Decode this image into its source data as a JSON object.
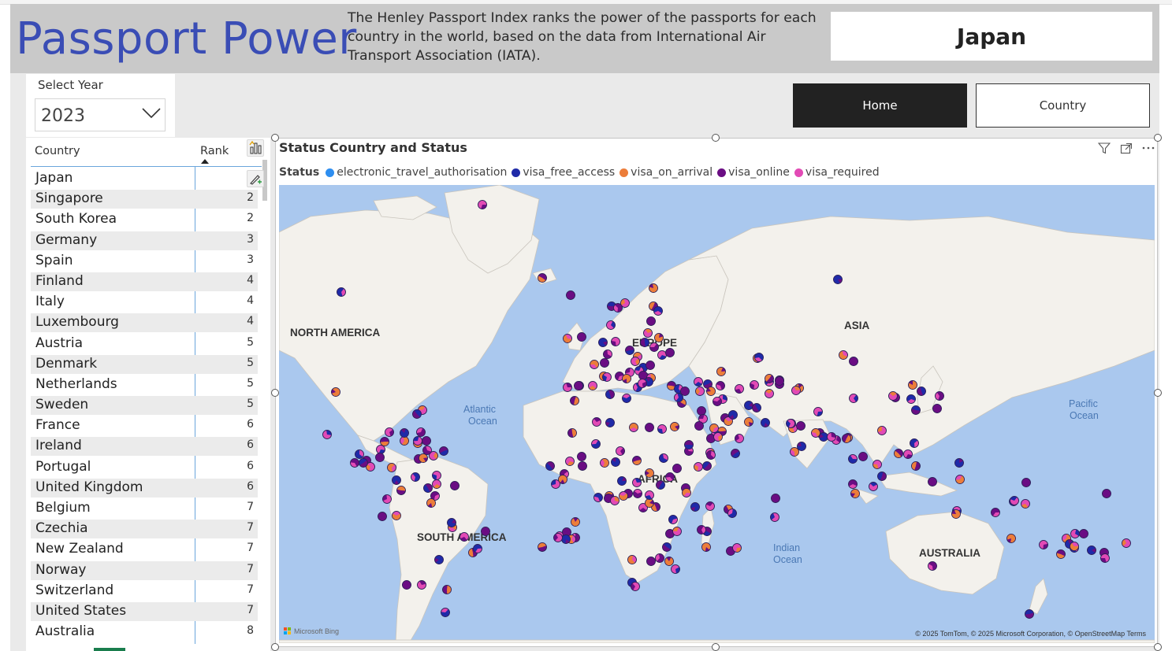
{
  "header": {
    "title": "Passport Power",
    "description": "The Henley Passport Index ranks the power of the passports for each country in the world, based on the data from International Air Transport Association (IATA).",
    "selected_country": "Japan"
  },
  "year_slicer": {
    "label": "Select Year",
    "value": "2023"
  },
  "nav": {
    "home_label": "Home",
    "country_label": "Country"
  },
  "rank_table": {
    "col_country": "Country",
    "col_rank": "Rank",
    "rows": [
      {
        "country": "Japan",
        "rank": ""
      },
      {
        "country": "Singapore",
        "rank": "2"
      },
      {
        "country": "South Korea",
        "rank": "2"
      },
      {
        "country": "Germany",
        "rank": "3"
      },
      {
        "country": "Spain",
        "rank": "3"
      },
      {
        "country": "Finland",
        "rank": "4"
      },
      {
        "country": "Italy",
        "rank": "4"
      },
      {
        "country": "Luxembourg",
        "rank": "4"
      },
      {
        "country": "Austria",
        "rank": "5"
      },
      {
        "country": "Denmark",
        "rank": "5"
      },
      {
        "country": "Netherlands",
        "rank": "5"
      },
      {
        "country": "Sweden",
        "rank": "5"
      },
      {
        "country": "France",
        "rank": "6"
      },
      {
        "country": "Ireland",
        "rank": "6"
      },
      {
        "country": "Portugal",
        "rank": "6"
      },
      {
        "country": "United Kingdom",
        "rank": "6"
      },
      {
        "country": "Belgium",
        "rank": "7"
      },
      {
        "country": "Czechia",
        "rank": "7"
      },
      {
        "country": "New Zealand",
        "rank": "7"
      },
      {
        "country": "Norway",
        "rank": "7"
      },
      {
        "country": "Switzerland",
        "rank": "7"
      },
      {
        "country": "United States",
        "rank": "7"
      },
      {
        "country": "Australia",
        "rank": "8"
      }
    ]
  },
  "map_visual": {
    "title": "Status Country and Status",
    "legend_title": "Status",
    "legend": [
      {
        "label": "electronic_travel_authorisation",
        "color": "#2e8ef0"
      },
      {
        "label": "visa_free_access",
        "color": "#1f2aa8"
      },
      {
        "label": "visa_on_arrival",
        "color": "#ec7d3a"
      },
      {
        "label": "visa_online",
        "color": "#6a0d83"
      },
      {
        "label": "visa_required",
        "color": "#e24ab5"
      }
    ],
    "labels": {
      "north_america": "NORTH AMERICA",
      "south_america": "SOUTH AMERICA",
      "europe": "EUROPE",
      "africa": "AFRICA",
      "asia": "ASIA",
      "australia": "AUSTRALIA",
      "atlantic1": "Atlantic",
      "atlantic2": "Ocean",
      "pacific1": "Pacific",
      "pacific2": "Ocean",
      "indian1": "Indian",
      "indian2": "Ocean"
    },
    "attribution": "© 2025 TomTom, © 2025 Microsoft Corporation, © OpenStreetMap  Terms",
    "bing_logo": "Microsoft Bing"
  }
}
